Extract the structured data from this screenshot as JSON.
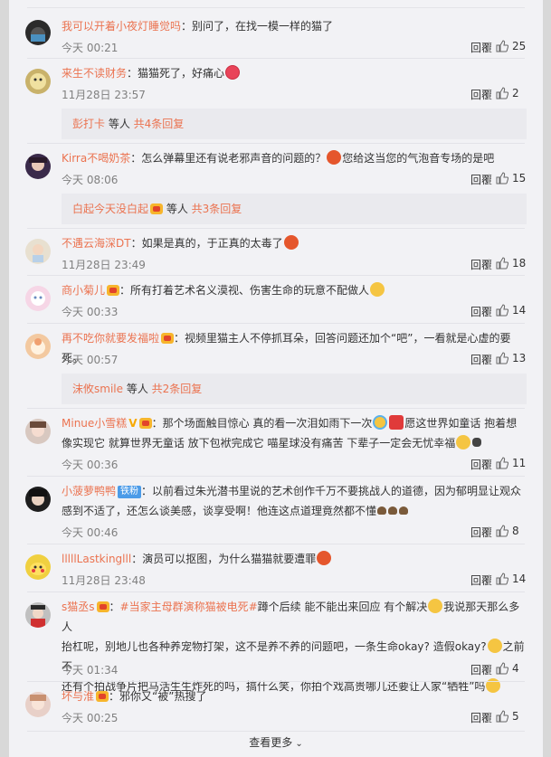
{
  "reply_label": "回覆",
  "comments": [
    {
      "name": "我可以开着小夜灯睡觉吗",
      "text": "：别问了，在找一模一样的猫了",
      "time": "今天 00:21",
      "likes": "25"
    },
    {
      "name": "来生不读财务",
      "text": "：猫猫死了，好痛心",
      "time": "11月28日 23:57",
      "likes": "2"
    },
    {
      "name": "Kirra不喝奶茶",
      "text": "：怎么弹幕里还有说老邪声音的问题的？",
      "text2": "您给这当您的气泡音专场的是吧",
      "time": "今天 08:06",
      "likes": "15"
    },
    {
      "name": "不遇云海深DT",
      "text": "：如果是真的，于正真的太毒了",
      "time": "11月28日 23:49",
      "likes": "18"
    },
    {
      "name": "商小菊儿",
      "text": "：所有打着艺术名义漠视、伤害生命的玩意不配做人",
      "time": "今天 00:33",
      "likes": "14"
    },
    {
      "name": "再不吃你就要发福啦",
      "text": "：视频里猫主人不停抓耳朵，回答问题还加个“吧”，一看就是心虚的要死。",
      "time": "今天 00:57",
      "likes": "13"
    },
    {
      "name": "Minue小雪糕",
      "badge_v": "V",
      "line1": "：那个场面触目惊心 真的看一次泪如雨下一次",
      "line1b": "愿这世界如童话 抱着想",
      "line2": "像实现它 就算世界无童话 放下包袱完成它 喵星球没有痛苦 下辈子一定会无忧幸福",
      "time": "今天 00:36",
      "likes": "11"
    },
    {
      "name": "小菠萝鸭鸭",
      "fan_badge": "铁粉",
      "line1": "：以前看过朱光潜书里说的艺术创作千万不要挑战人的道德，因为郁明显让观众",
      "line2": "感到不适了，还怎么谈美感，谈享受啊！他连这点道理竟然都不懂",
      "time": "今天 00:46",
      "likes": "8"
    },
    {
      "name": "lllllLastkinglll",
      "text": "：演员可以抠图，为什么猫猫就要遭罪",
      "time": "11月28日 23:48",
      "likes": "14"
    },
    {
      "name": "s猫丞s",
      "hashtag": "#当家主母群演称猫被电死#",
      "line1": "蹲个后续 能不能出来回应 有个解决",
      "line1b": "我说那天那么多人",
      "line2a": "抬杠呢，别地儿也各种养宠物打架，这不是养不养的问题吧，一条生命okay? 造假okay?",
      "line2b": "之前不",
      "line3": "还有个拍战争片把马活生生炸死的吗，搞什么笑，你拍个戏高贵哪儿还要让人家“牺牲”吗",
      "time": "今天 01:34",
      "likes": "4"
    },
    {
      "name": "坏与淮",
      "text": "：邪你又“被”热搜了",
      "time": "今天 00:25",
      "likes": "5"
    }
  ],
  "reply_groups": [
    {
      "name": "彭打卡",
      "mid": " 等人 ",
      "count": "共4条回复"
    },
    {
      "name": "白起今天没白起",
      "mid": " 等人 ",
      "count": "共3条回复"
    },
    {
      "name": "沫攸smile",
      "mid": " 等人 ",
      "count": "共2条回复"
    }
  ],
  "footer": {
    "label": "查看更多"
  },
  "colors": {
    "name": "#eb7350",
    "background": "#f2f2f5",
    "reply_box": "#eaeaee"
  }
}
